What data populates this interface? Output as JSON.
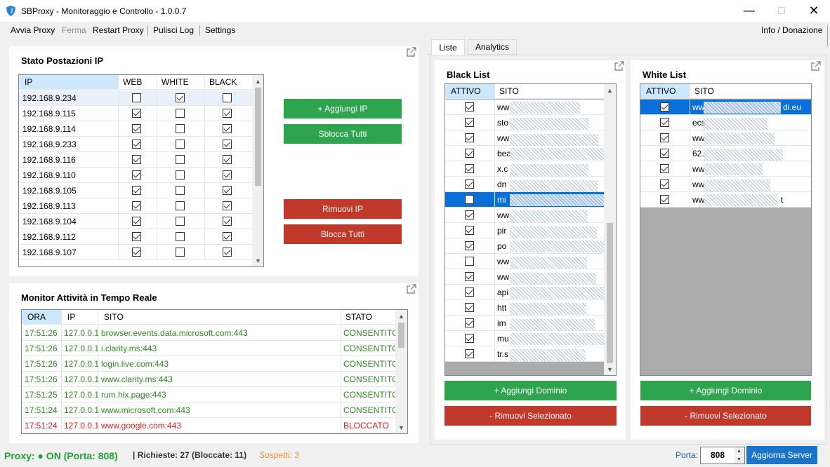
{
  "window": {
    "title": "SBProxy - Monitoraggio e Controllo - 1.0.0.7"
  },
  "menu": {
    "start": "Avvia Proxy",
    "stop": "Ferma",
    "restart": "Restart Proxy",
    "clear_log": "Pulisci Log",
    "settings": "Settings",
    "info": "Info / Donazione"
  },
  "ip_panel": {
    "title": "Stato Postazioni IP",
    "headers": {
      "ip": "IP",
      "web": "WEB",
      "white": "WHITE",
      "black": "BLACK"
    },
    "rows": [
      {
        "ip": "192.168.9.234",
        "web": false,
        "white": true,
        "black": false
      },
      {
        "ip": "192.168.9.115",
        "web": true,
        "white": false,
        "black": true
      },
      {
        "ip": "192.168.9.114",
        "web": true,
        "white": false,
        "black": true
      },
      {
        "ip": "192.168.9.233",
        "web": true,
        "white": false,
        "black": true
      },
      {
        "ip": "192.168.9.116",
        "web": true,
        "white": false,
        "black": true
      },
      {
        "ip": "192.168.9.110",
        "web": true,
        "white": false,
        "black": true
      },
      {
        "ip": "192.168.9.105",
        "web": true,
        "white": false,
        "black": true
      },
      {
        "ip": "192.168.9.113",
        "web": true,
        "white": false,
        "black": true
      },
      {
        "ip": "192.168.9.104",
        "web": true,
        "white": false,
        "black": true
      },
      {
        "ip": "192.168.9.112",
        "web": true,
        "white": false,
        "black": true
      },
      {
        "ip": "192.168.9.107",
        "web": true,
        "white": false,
        "black": true
      }
    ],
    "buttons": {
      "add": "+ Aggiungi IP",
      "unlock_all": "Sblocca Tutti",
      "remove": "Rimuovi IP",
      "block_all": "Blocca Tutti"
    }
  },
  "monitor": {
    "title": "Monitor Attività in Tempo Reale",
    "headers": {
      "time": "ORA",
      "ip": "IP",
      "site": "SITO",
      "status": "STATO"
    },
    "rows": [
      {
        "time": "17:51:26",
        "ip": "127.0.0.1",
        "site": "browser.events.data.microsoft.com:443",
        "status": "CONSENTITO",
        "color": "#2e8b1e"
      },
      {
        "time": "17:51:26",
        "ip": "127.0.0.1",
        "site": "i.clarity.ms:443",
        "status": "CONSENTITO",
        "color": "#2e8b1e"
      },
      {
        "time": "17:51:26",
        "ip": "127.0.0.1",
        "site": "login.live.com:443",
        "status": "CONSENTITO",
        "color": "#2e8b1e"
      },
      {
        "time": "17:51:26",
        "ip": "127.0.0.1",
        "site": "www.clarity.ms:443",
        "status": "CONSENTITO",
        "color": "#2e8b1e"
      },
      {
        "time": "17:51:25",
        "ip": "127.0.0.1",
        "site": "rum.hlx.page:443",
        "status": "CONSENTITO",
        "color": "#2e8b1e"
      },
      {
        "time": "17:51:24",
        "ip": "127.0.0.1",
        "site": "www.microsoft.com:443",
        "status": "CONSENTITO",
        "color": "#2e8b1e"
      },
      {
        "time": "17:51:24",
        "ip": "127.0.0.1",
        "site": "www.google.com:443",
        "status": "BLOCCATO",
        "color": "#e02020"
      }
    ]
  },
  "tabs": {
    "lists": "Liste",
    "analytics": "Analytics"
  },
  "blacklist": {
    "title": "Black List",
    "headers": {
      "active": "ATTIVO",
      "site": "SITO"
    },
    "rows": [
      {
        "active": true,
        "site": "ww"
      },
      {
        "active": true,
        "site": "sto"
      },
      {
        "active": true,
        "site": "ww"
      },
      {
        "active": true,
        "site": "bea"
      },
      {
        "active": true,
        "site": "x.c"
      },
      {
        "active": true,
        "site": "dn"
      },
      {
        "active": false,
        "site": "mi"
      },
      {
        "active": true,
        "site": "ww"
      },
      {
        "active": true,
        "site": "pir"
      },
      {
        "active": true,
        "site": "po"
      },
      {
        "active": false,
        "site": "ww"
      },
      {
        "active": true,
        "site": "ww"
      },
      {
        "active": true,
        "site": "api"
      },
      {
        "active": true,
        "site": "htt"
      },
      {
        "active": true,
        "site": "im"
      },
      {
        "active": true,
        "site": "mu"
      },
      {
        "active": true,
        "site": "tr.s"
      }
    ],
    "buttons": {
      "add": "+ Aggiungi Dominio",
      "remove": "- Rimuovi Selezionato"
    }
  },
  "whitelist": {
    "title": "White List",
    "headers": {
      "active": "ATTIVO",
      "site": "SITO"
    },
    "rows": [
      {
        "active": true,
        "site": "ww",
        "suffix": "di.eu"
      },
      {
        "active": true,
        "site": "ecs",
        "suffix": ""
      },
      {
        "active": true,
        "site": "ww",
        "suffix": ""
      },
      {
        "active": true,
        "site": "62.",
        "suffix": ""
      },
      {
        "active": true,
        "site": "ww",
        "suffix": ""
      },
      {
        "active": true,
        "site": "ww",
        "suffix": ""
      },
      {
        "active": true,
        "site": "ww",
        "suffix": "t"
      }
    ],
    "buttons": {
      "add": "+ Aggiungi Dominio",
      "remove": "- Rimuovi Selezionato"
    }
  },
  "status": {
    "proxy": "Proxy: ● ON (Porta: 808)",
    "requests": "| Richieste: 27 (Bloccate: 11)",
    "suspects": "Sospetti: 3",
    "port_label": "Porta:",
    "port_value": "808",
    "update_button": "Aggiorna Server"
  }
}
